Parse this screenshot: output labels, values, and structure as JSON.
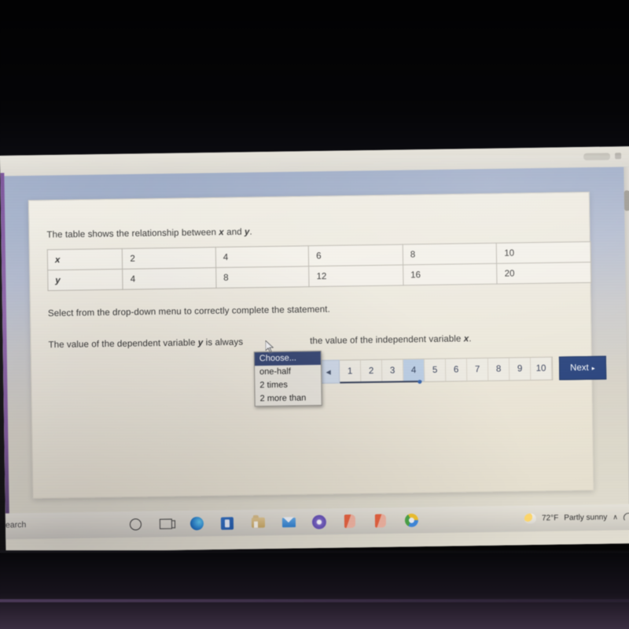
{
  "window": {
    "controls": [
      "minimize-pill",
      "restore-dot"
    ]
  },
  "question": {
    "intro_before": "The table shows the relationship between ",
    "intro_var1": "x",
    "intro_mid": " and ",
    "intro_var2": "y",
    "intro_end": ".",
    "instruction": "Select from the drop-down menu to correctly complete the statement.",
    "statement_part1": "The value of the dependent variable ",
    "statement_var1": "y",
    "statement_part2": " is always",
    "statement_part3": "the value of the independent variable ",
    "statement_var2": "x",
    "statement_end": "."
  },
  "table": {
    "rows": [
      {
        "label": "x",
        "values": [
          "2",
          "4",
          "6",
          "8",
          "10"
        ]
      },
      {
        "label": "y",
        "values": [
          "4",
          "8",
          "12",
          "16",
          "20"
        ]
      }
    ]
  },
  "dropdown": {
    "options": [
      "Choose...",
      "one-half",
      "2 times",
      "2 more than"
    ],
    "selected": "Choose...",
    "selected_index": 0
  },
  "pager": {
    "prev_icon": "caret-left-icon",
    "prev_glyph": "◀",
    "pages": [
      "1",
      "2",
      "3",
      "4",
      "5",
      "6",
      "7",
      "8",
      "9",
      "10"
    ],
    "current_page": "4",
    "next_label": "Next",
    "next_caret": "▸"
  },
  "taskbar": {
    "search_label": "earch",
    "icons": [
      {
        "name": "cortana-icon"
      },
      {
        "name": "task-view-icon"
      },
      {
        "name": "microsoft-edge-icon"
      },
      {
        "name": "store-app-icon"
      },
      {
        "name": "file-explorer-icon"
      },
      {
        "name": "mail-icon"
      },
      {
        "name": "circle-app-icon"
      },
      {
        "name": "office-app-icon"
      },
      {
        "name": "office-app-icon-2"
      },
      {
        "name": "chrome-icon"
      }
    ],
    "weather_temp": "72°F",
    "weather_text": "Partly sunny",
    "tray_chevron": "∧"
  },
  "colors": {
    "accent_button": "#1f3b78",
    "dropdown_highlight": "#2d3e6d",
    "page_current": "#b9cde5",
    "card_bg": "#f0ece1",
    "page_bg_top": "#97a6c4",
    "left_edge_purple": "#8a5ba8"
  }
}
